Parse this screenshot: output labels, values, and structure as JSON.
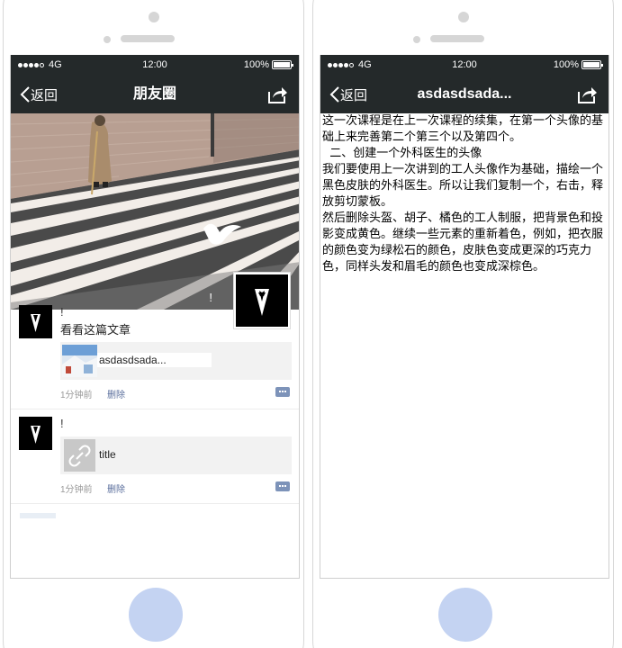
{
  "status_bar": {
    "network": "4G",
    "time": "12:00",
    "battery": "100%"
  },
  "left": {
    "nav": {
      "back_label": "返回",
      "title": "朋友圈"
    },
    "cover_exclaim": "!",
    "posts": [
      {
        "name": "!",
        "text": "看看这篇文章",
        "link_title": "asdasdsada...",
        "time": "1分钟前",
        "delete_label": "删除"
      },
      {
        "name": "!",
        "text": "",
        "link_title": "title",
        "time": "1分钟前",
        "delete_label": "删除"
      }
    ]
  },
  "right": {
    "nav": {
      "back_label": "返回",
      "title": "asdasdsada..."
    },
    "article": [
      "这一次课程是在上一次课程的续集，在第一个头像的基础上来完善第二个第三个以及第四个。",
      "  二、创建一个外科医生的头像",
      "我们要使用上一次讲到的工人头像作为基础，描绘一个黑色皮肤的外科医生。所以让我们复制一个，右击，释放剪切蒙板。",
      "然后删除头盔、胡子、橘色的工人制服，把背景色和投影变成黄色。继续一些元素的重新着色，例如，把衣服的颜色变为绿松石的颜色，皮肤色变成更深的巧克力色，同样头发和眉毛的颜色也变成深棕色。"
    ]
  },
  "colors": {
    "bar": "#24292a",
    "home_button": "#c4d3f2",
    "link": "#5a6e9c",
    "comment": "#7d93b9"
  },
  "icons": [
    "chevron-left-icon",
    "share-icon",
    "link-icon",
    "comment-icon"
  ]
}
